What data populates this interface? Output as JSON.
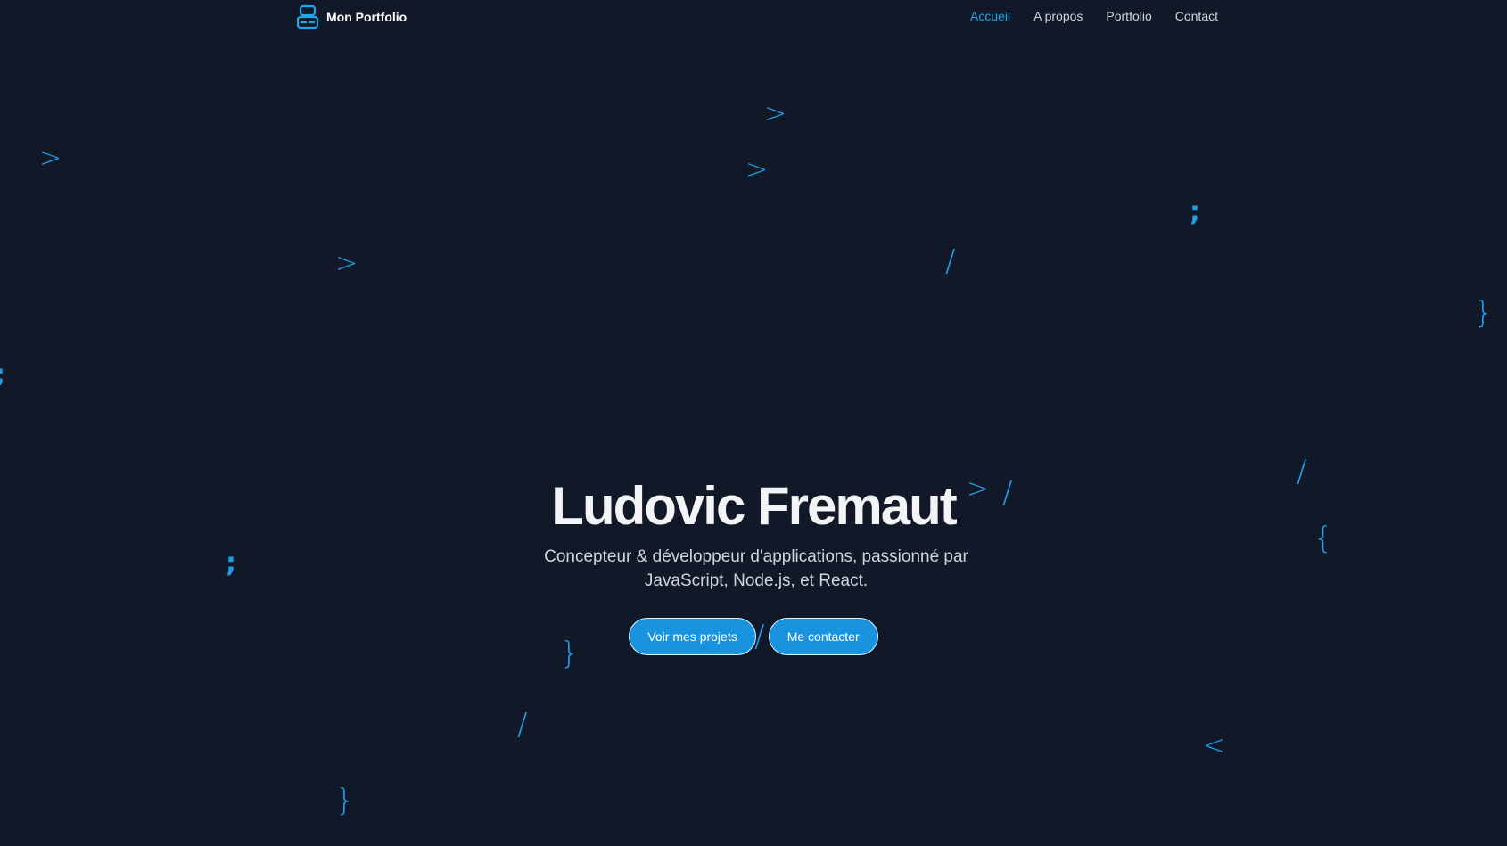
{
  "header": {
    "brand": {
      "icon": "server-icon",
      "label": "Mon Portfolio"
    },
    "nav": [
      {
        "label": "Accueil",
        "active": true
      },
      {
        "label": "A propos",
        "active": false
      },
      {
        "label": "Portfolio",
        "active": false
      },
      {
        "label": "Contact",
        "active": false
      }
    ]
  },
  "hero": {
    "title": "Ludovic Fremaut",
    "subtitle": "Concepteur & développeur d'applications, passionné par JavaScript, Node.js, et React.",
    "buttons": {
      "projects": "Voir mes projets",
      "contact": "Me contacter"
    }
  },
  "background_glyphs": [
    ">",
    ">",
    ">",
    ";",
    "/",
    "}",
    ">",
    ";",
    "/",
    "/",
    "{",
    ";",
    "}",
    "/",
    "/",
    "<",
    "}",
    ">"
  ],
  "colors": {
    "background": "#111827",
    "accent": "#22a6e8",
    "button": "#1a93de",
    "title": "#f3f4f6"
  }
}
